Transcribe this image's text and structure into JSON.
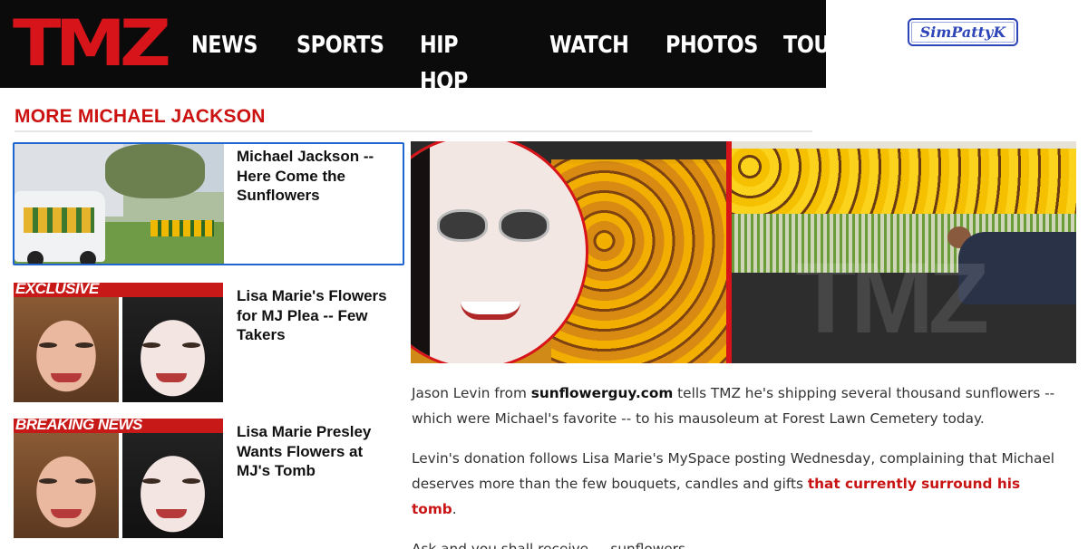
{
  "header": {
    "logo": "TMZ",
    "nav": [
      "NEWS",
      "SPORTS",
      "HIP HOP",
      "WATCH",
      "PHOTOS",
      "TOURS"
    ]
  },
  "watermark": "SimPattyK",
  "section": {
    "title": "MORE MICHAEL JACKSON"
  },
  "stories": [
    {
      "title": "Michael Jackson -- Here Come the Sunflowers",
      "banner": ""
    },
    {
      "title": "Lisa Marie's Flowers for MJ Plea -- Few Takers",
      "banner": "EXCLUSIVE"
    },
    {
      "title": "Lisa Marie Presley Wants Flowers at MJ's Tomb",
      "banner": "BREAKING NEWS"
    }
  ],
  "hero": {
    "watermark": "TMZ"
  },
  "article": {
    "p1_a": "Jason Levin from ",
    "p1_link": "sunflowerguy.com",
    "p1_b": " tells TMZ he's shipping several thousand sunflowers -- which were Michael's favorite -- to his mausoleum at Forest Lawn Cemetery today.",
    "p2_a": "Levin's donation follows Lisa Marie's MySpace posting Wednesday, complaining that Michael deserves more than the few bouquets, candles and gifts ",
    "p2_link": "that currently surround his tomb",
    "p2_b": ".",
    "p3": "Ask and you shall receive ... sunflowers."
  },
  "colors": {
    "brand_red": "#d7141a",
    "link_red": "#c91414",
    "header_bg": "#0b0b0b",
    "selected_border": "#1f66d1"
  }
}
